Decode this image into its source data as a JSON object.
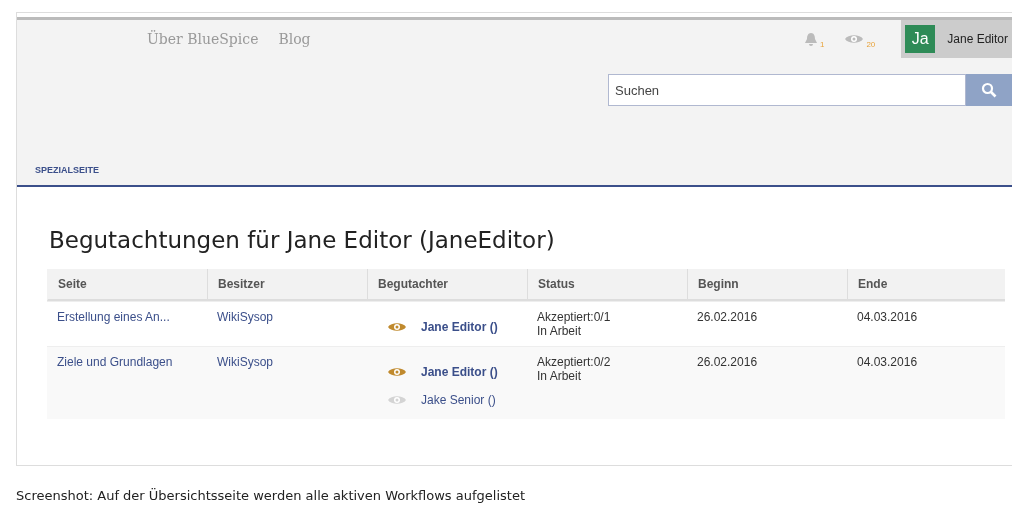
{
  "nav": {
    "links": [
      "Über BlueSpice",
      "Blog"
    ],
    "notifications": "1",
    "watch_count": "20",
    "avatar": "Ja",
    "user": "Jane Editor"
  },
  "search": {
    "placeholder": "Suchen"
  },
  "tab": "SPEZIALSEITE",
  "title": "Begutachtungen für Jane Editor (JaneEditor)",
  "table": {
    "columns": [
      "Seite",
      "Besitzer",
      "Begutachter",
      "Status",
      "Beginn",
      "Ende"
    ],
    "rows": [
      {
        "page": "Erstellung eines An...",
        "owner": "WikiSysop",
        "reviewers": [
          {
            "name": "Jane Editor ()",
            "active": true
          }
        ],
        "status": [
          "Akzeptiert:0/1",
          "In Arbeit"
        ],
        "start": "26.02.2016",
        "end": "04.03.2016"
      },
      {
        "page": "Ziele und Grundlagen",
        "owner": "WikiSysop",
        "reviewers": [
          {
            "name": "Jane Editor ()",
            "active": true
          },
          {
            "name": "Jake Senior ()",
            "active": false
          }
        ],
        "status": [
          "Akzeptiert:0/2",
          "In Arbeit"
        ],
        "start": "26.02.2016",
        "end": "04.03.2016"
      }
    ]
  },
  "caption": "Screenshot: Auf der Übersichtsseite werden alle aktiven Workflows aufgelistet"
}
